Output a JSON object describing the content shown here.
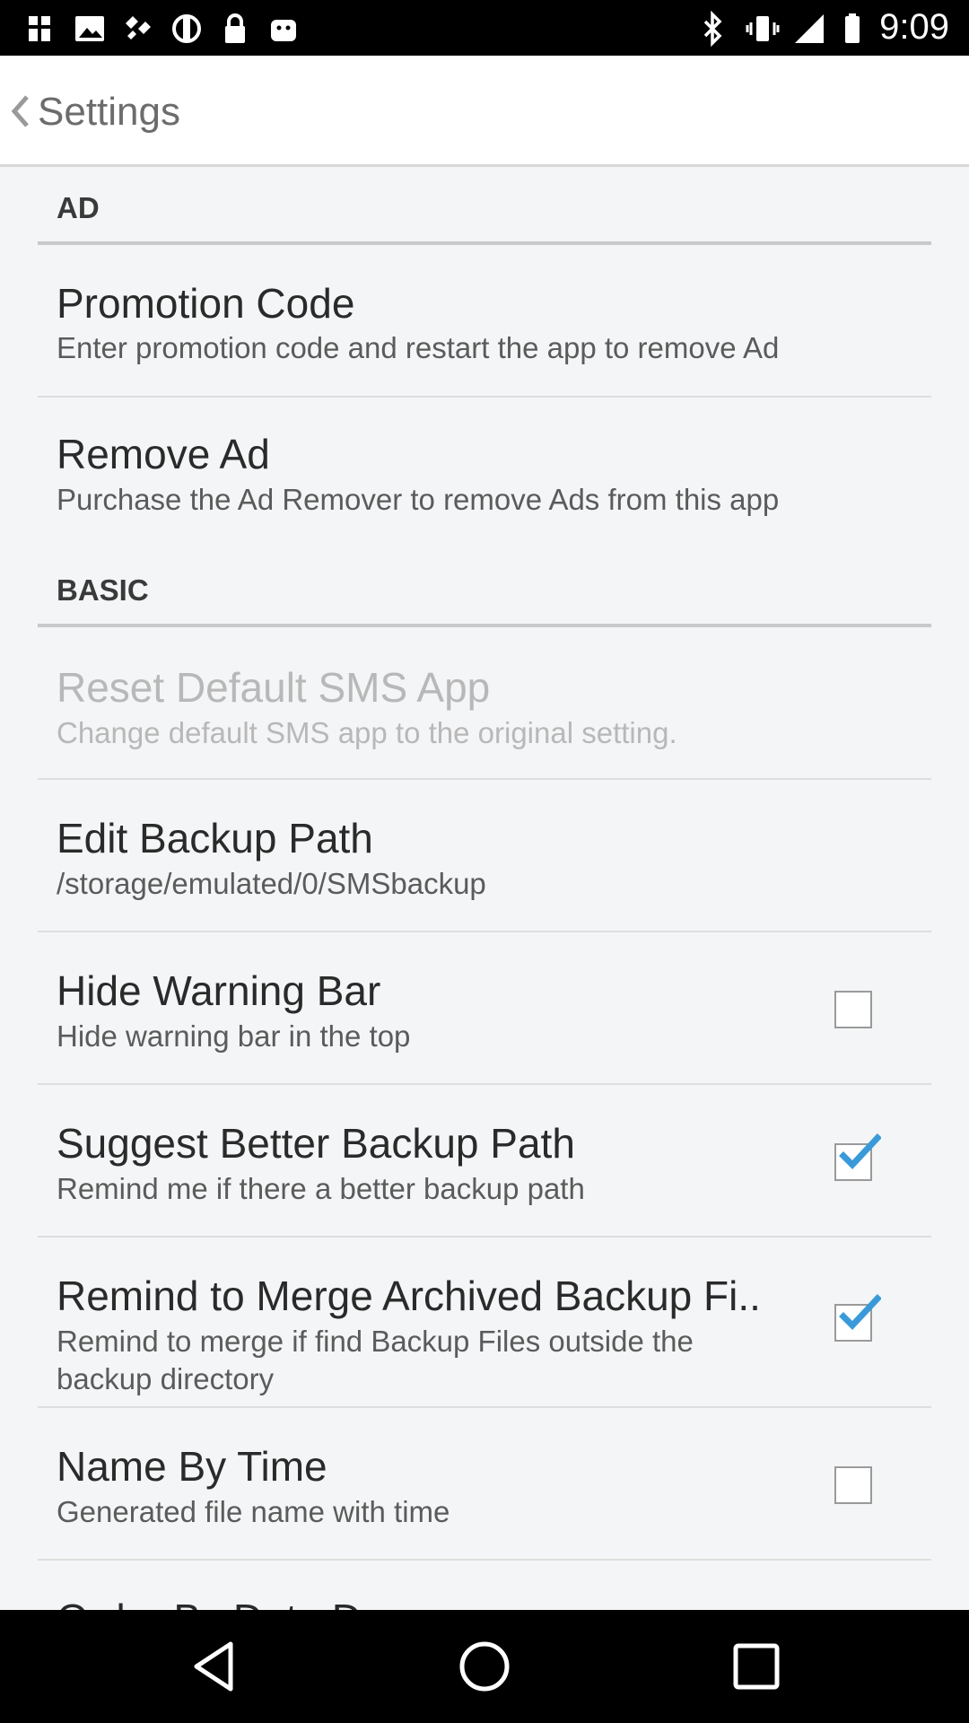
{
  "status_bar": {
    "time": "9:09",
    "left_icons": [
      "photos-icon",
      "image-icon",
      "fake-gps-icon",
      "sync-icon",
      "lock-icon",
      "android-icon"
    ],
    "right_icons": [
      "bluetooth-icon",
      "vibrate-icon",
      "signal-icon",
      "battery-icon"
    ]
  },
  "action_bar": {
    "title": "Settings"
  },
  "sections": {
    "ad": {
      "header": "AD",
      "promotion_code": {
        "title": "Promotion Code",
        "summary": "Enter promotion code and restart the app to remove Ad"
      },
      "remove_ad": {
        "title": "Remove Ad",
        "summary": "Purchase the Ad Remover to remove Ads from this app"
      }
    },
    "basic": {
      "header": "BASIC",
      "reset_sms": {
        "title": "Reset Default SMS App",
        "summary": "Change default SMS app to the original setting.",
        "enabled": false
      },
      "edit_backup_path": {
        "title": "Edit Backup Path",
        "summary": "/storage/emulated/0/SMSbackup"
      },
      "hide_warning_bar": {
        "title": "Hide Warning Bar",
        "summary": "Hide warning bar in the top",
        "checked": false
      },
      "suggest_backup_path": {
        "title": "Suggest Better Backup Path",
        "summary": "Remind me if there a better backup path",
        "checked": true
      },
      "remind_merge": {
        "title": "Remind to Merge Archived Backup Fi..",
        "summary": "Remind to merge if find Backup Files outside the backup directory",
        "checked": true
      },
      "name_by_time": {
        "title": "Name By Time",
        "summary": "Generated file name with time",
        "checked": false
      },
      "order_by_date": {
        "title": "Order By Date Desc"
      }
    }
  },
  "nav_bar": {
    "buttons": [
      "back-icon",
      "home-icon",
      "recents-icon"
    ]
  },
  "colors": {
    "check_accent": "#3a9ad9",
    "background": "#f4f5f6"
  }
}
